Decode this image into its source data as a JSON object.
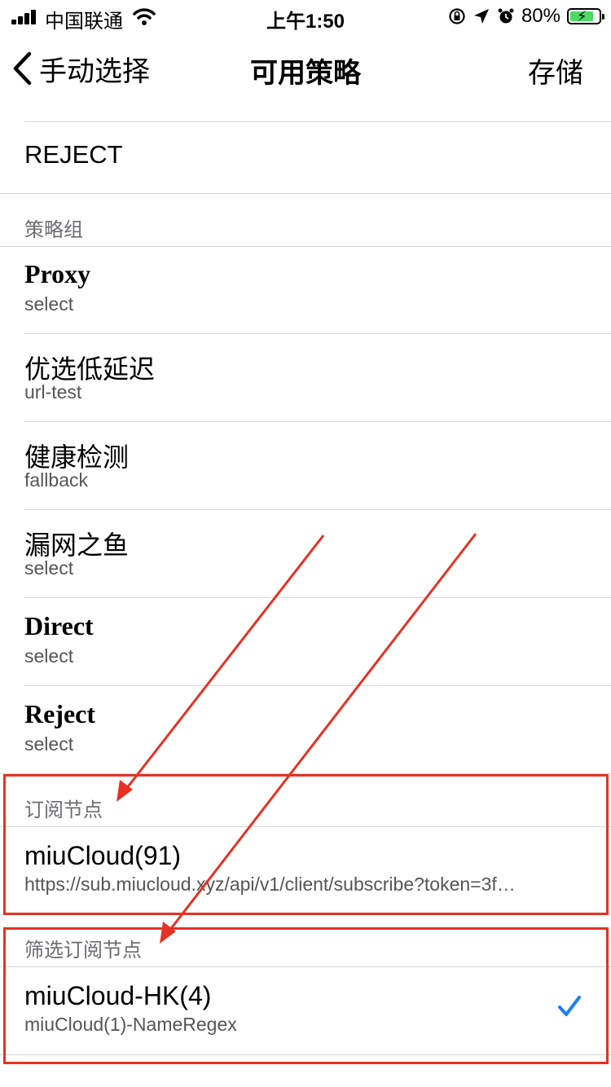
{
  "status_bar": {
    "carrier": "中国联通",
    "time": "上午1:50",
    "battery": "80%"
  },
  "nav": {
    "back_label": "手动选择",
    "title": "可用策略",
    "save_label": "存储"
  },
  "builtin": {
    "reject": "REJECT"
  },
  "policy_groups": {
    "header": "策略组",
    "items": [
      {
        "name": "Proxy",
        "type": "select"
      },
      {
        "name": "优选低延迟",
        "type": "url-test"
      },
      {
        "name": "健康检测",
        "type": "fallback"
      },
      {
        "name": "漏网之鱼",
        "type": "select"
      },
      {
        "name": "Direct",
        "type": "select"
      },
      {
        "name": "Reject",
        "type": "select"
      }
    ]
  },
  "subscription": {
    "header": "订阅节点",
    "item": {
      "name": "miuCloud(91)",
      "url": "https://sub.miucloud.xyz/api/v1/client/subscribe?token=3f…"
    }
  },
  "filtered_subscription": {
    "header": "筛选订阅节点",
    "item": {
      "name": "miuCloud-HK(4)",
      "rule": "miuCloud(1)-NameRegex",
      "checked": true
    }
  },
  "colors": {
    "annotation_red": "#e53224",
    "check_blue": "#1e7ff0"
  }
}
